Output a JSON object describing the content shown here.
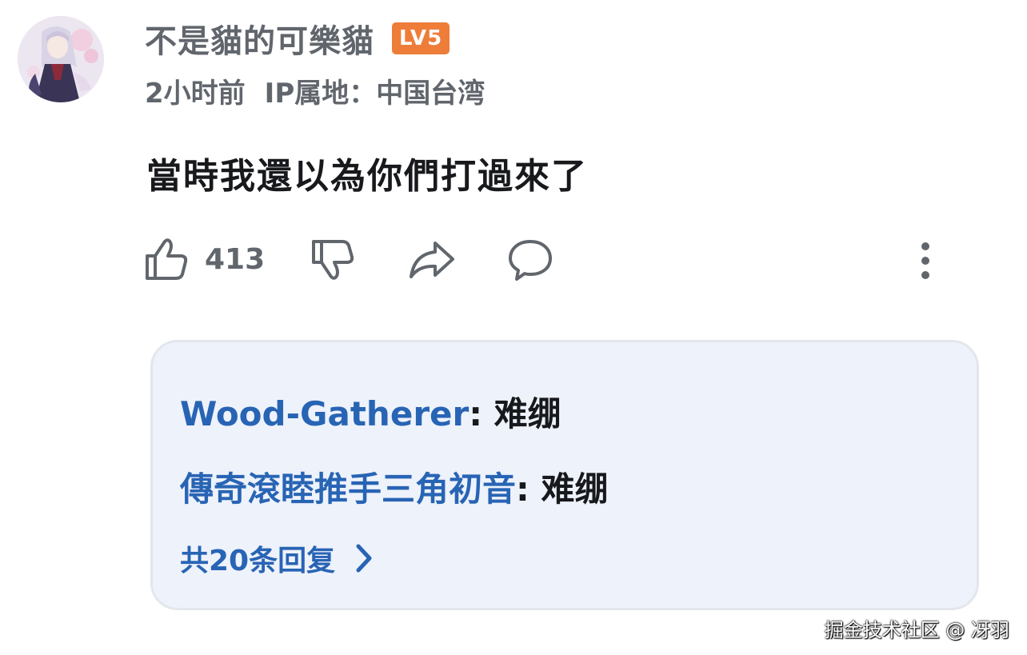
{
  "comment": {
    "username": "不是貓的可樂貓",
    "level_badge": "LV5",
    "time": "2小时前",
    "ip_location": "IP属地：中国台湾",
    "text": "當時我還以為你們打過來了",
    "like_count": "413"
  },
  "icons": {
    "like": "thumbs-up-icon",
    "dislike": "thumbs-down-icon",
    "share": "share-arrow-icon",
    "reply": "chat-bubble-icon",
    "more": "more-vertical-icon",
    "expand": "chevron-right-icon"
  },
  "replies": {
    "items": [
      {
        "author": "Wood-Gatherer",
        "separator": ":",
        "text": "难绷"
      },
      {
        "author": "傳奇滾睦推手三角初音",
        "separator": ":",
        "text": "难绷"
      }
    ],
    "more_label": "共20条回复"
  },
  "watermark": "掘金技术社区 @ 冴羽",
  "colors": {
    "username": "#61666d",
    "level_badge": "#ee7d3a",
    "reply_author": "#2864b4",
    "replies_background": "#eef2fb",
    "text": "#18191c"
  }
}
